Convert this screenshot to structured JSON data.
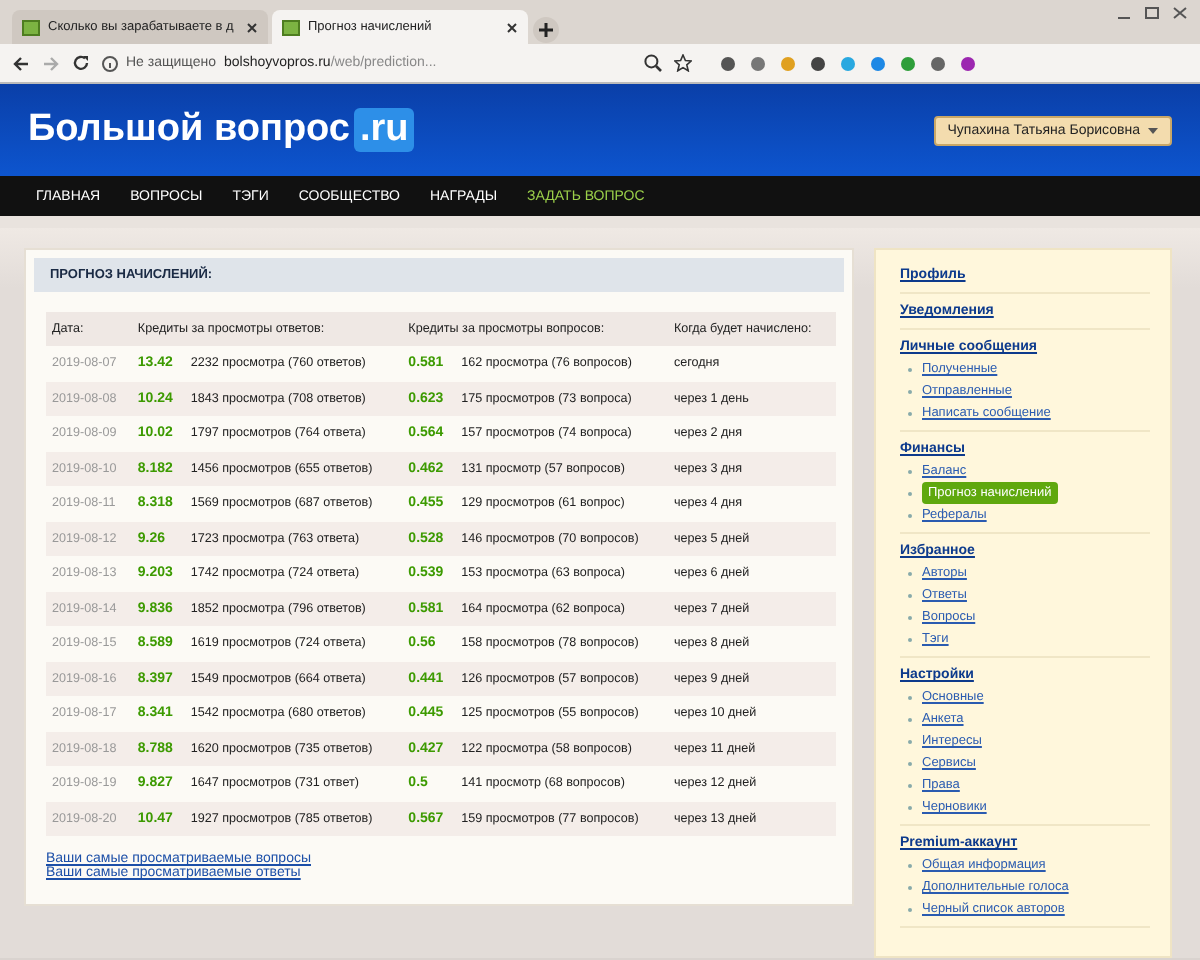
{
  "browser": {
    "tabs": [
      {
        "title": "Сколько вы зарабатываете в д",
        "selected": false
      },
      {
        "title": "Прогноз начислений",
        "selected": true
      }
    ],
    "security": "Не защищено",
    "url_host": "bolshoyvopros.ru",
    "url_path": "/web/prediction..."
  },
  "site": {
    "logo": "Большой вопрос",
    "logo_suffix": ".ru",
    "user": "Чупахина Татьяна Борисовна",
    "nav": [
      {
        "label": "ГЛАВНАЯ",
        "kind": "link"
      },
      {
        "label": "ВОПРОСЫ",
        "kind": "link"
      },
      {
        "label": "ТЭГИ",
        "kind": "link"
      },
      {
        "label": "СООБЩЕСТВО",
        "kind": "link"
      },
      {
        "label": "НАГРАДЫ",
        "kind": "link"
      },
      {
        "label": "ЗАДАТЬ ВОПРОС",
        "kind": "action"
      }
    ]
  },
  "panel": {
    "title": "ПРОГНОЗ НАЧИСЛЕНИЙ:",
    "columns": [
      "Дата:",
      "Кредиты за просмотры ответов:",
      "Кредиты за просмотры вопросов:",
      "Когда будет начислено:"
    ],
    "rows": [
      {
        "date": "2019-08-07",
        "answer_credits": "13.42",
        "answer_views": "2232 просмотра (760 ответов)",
        "question_credits": "0.581",
        "question_views": "162 просмотра (76 вопросов)",
        "when": "сегодня"
      },
      {
        "date": "2019-08-08",
        "answer_credits": "10.24",
        "answer_views": "1843 просмотра (708 ответов)",
        "question_credits": "0.623",
        "question_views": "175 просмотров (73 вопроса)",
        "when": "через 1 день"
      },
      {
        "date": "2019-08-09",
        "answer_credits": "10.02",
        "answer_views": "1797 просмотров (764 ответа)",
        "question_credits": "0.564",
        "question_views": "157 просмотров (74 вопроса)",
        "when": "через 2 дня"
      },
      {
        "date": "2019-08-10",
        "answer_credits": "8.182",
        "answer_views": "1456 просмотров (655 ответов)",
        "question_credits": "0.462",
        "question_views": "131 просмотр (57 вопросов)",
        "when": "через 3 дня"
      },
      {
        "date": "2019-08-11",
        "answer_credits": "8.318",
        "answer_views": "1569 просмотров (687 ответов)",
        "question_credits": "0.455",
        "question_views": "129 просмотров (61 вопрос)",
        "when": "через 4 дня"
      },
      {
        "date": "2019-08-12",
        "answer_credits": "9.26",
        "answer_views": "1723 просмотра (763 ответа)",
        "question_credits": "0.528",
        "question_views": "146 просмотров (70 вопросов)",
        "when": "через 5 дней"
      },
      {
        "date": "2019-08-13",
        "answer_credits": "9.203",
        "answer_views": "1742 просмотра (724 ответа)",
        "question_credits": "0.539",
        "question_views": "153 просмотра (63 вопроса)",
        "when": "через 6 дней"
      },
      {
        "date": "2019-08-14",
        "answer_credits": "9.836",
        "answer_views": "1852 просмотра (796 ответов)",
        "question_credits": "0.581",
        "question_views": "164 просмотра (62 вопроса)",
        "when": "через 7 дней"
      },
      {
        "date": "2019-08-15",
        "answer_credits": "8.589",
        "answer_views": "1619 просмотров (724 ответа)",
        "question_credits": "0.56",
        "question_views": "158 просмотров (78 вопросов)",
        "when": "через 8 дней"
      },
      {
        "date": "2019-08-16",
        "answer_credits": "8.397",
        "answer_views": "1549 просмотров (664 ответа)",
        "question_credits": "0.441",
        "question_views": "126 просмотров (57 вопросов)",
        "when": "через 9 дней"
      },
      {
        "date": "2019-08-17",
        "answer_credits": "8.341",
        "answer_views": "1542 просмотра (680 ответов)",
        "question_credits": "0.445",
        "question_views": "125 просмотров (55 вопросов)",
        "when": "через 10 дней"
      },
      {
        "date": "2019-08-18",
        "answer_credits": "8.788",
        "answer_views": "1620 просмотров (735 ответов)",
        "question_credits": "0.427",
        "question_views": "122 просмотра (58 вопросов)",
        "when": "через 11 дней"
      },
      {
        "date": "2019-08-19",
        "answer_credits": "9.827",
        "answer_views": "1647 просмотров (731 ответ)",
        "question_credits": "0.5",
        "question_views": "141 просмотр (68 вопросов)",
        "when": "через 12 дней"
      },
      {
        "date": "2019-08-20",
        "answer_credits": "10.47",
        "answer_views": "1927 просмотров (785 ответов)",
        "question_credits": "0.567",
        "question_views": "159 просмотров (77 вопросов)",
        "when": "через 13 дней"
      }
    ],
    "links": [
      "Ваши самые просматриваемые вопросы",
      "Ваши самые просматриваемые ответы"
    ]
  },
  "sidebar": {
    "sections": [
      {
        "title": "Профиль"
      },
      {
        "title": "Уведомления"
      },
      {
        "title": "Личные сообщения",
        "items": [
          {
            "label": "Полученные",
            "selected": false
          },
          {
            "label": "Отправленные",
            "selected": false
          },
          {
            "label": "Написать сообщение",
            "selected": false
          }
        ]
      },
      {
        "title": "Финансы",
        "items": [
          {
            "label": "Баланс",
            "selected": false
          },
          {
            "label": "Прогноз начислений",
            "selected": true
          },
          {
            "label": "Рефералы",
            "selected": false
          }
        ]
      },
      {
        "title": "Избранное",
        "items": [
          {
            "label": "Авторы",
            "selected": false
          },
          {
            "label": "Ответы",
            "selected": false
          },
          {
            "label": "Вопросы",
            "selected": false
          },
          {
            "label": "Тэги",
            "selected": false
          }
        ]
      },
      {
        "title": "Настройки",
        "items": [
          {
            "label": "Основные",
            "selected": false
          },
          {
            "label": "Анкета",
            "selected": false
          },
          {
            "label": "Интересы",
            "selected": false
          },
          {
            "label": "Сервисы",
            "selected": false
          },
          {
            "label": "Права",
            "selected": false
          },
          {
            "label": "Черновики",
            "selected": false
          }
        ]
      },
      {
        "title": "Premium-аккаунт",
        "items": [
          {
            "label": "Общая информация",
            "selected": false
          },
          {
            "label": "Дополнительные голоса",
            "selected": false
          },
          {
            "label": "Черный список авторов",
            "selected": false
          }
        ]
      }
    ]
  }
}
